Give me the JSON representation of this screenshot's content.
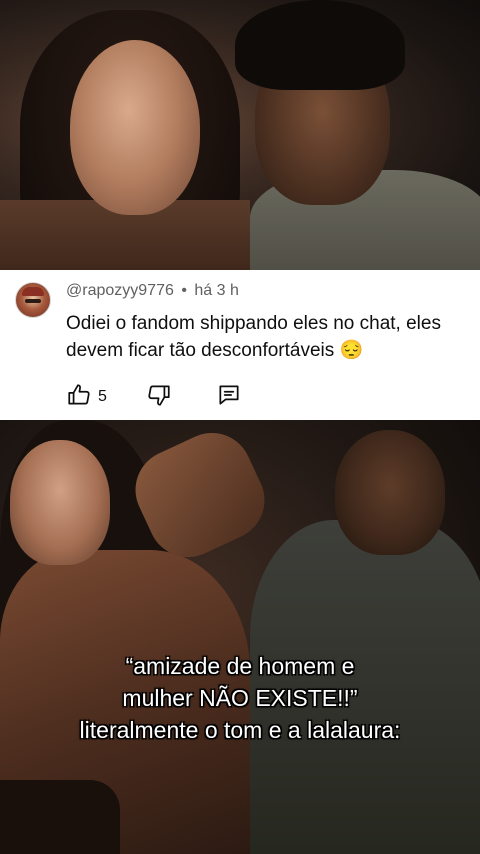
{
  "comment": {
    "username": "@rapozyy9776",
    "separator": "•",
    "time": "há 3 h",
    "text": "Odiei o fandom shippando eles no chat, eles devem ficar tão desconfortáveis 😔",
    "likes": "5",
    "icons": {
      "like": "thumbs-up-icon",
      "dislike": "thumbs-down-icon",
      "reply": "comment-reply-icon"
    }
  },
  "caption": {
    "line1": "“amizade de homem e",
    "line2": "mulher NÃO EXISTE!!”",
    "line3": "literalmente o tom e a lalalaura:"
  }
}
